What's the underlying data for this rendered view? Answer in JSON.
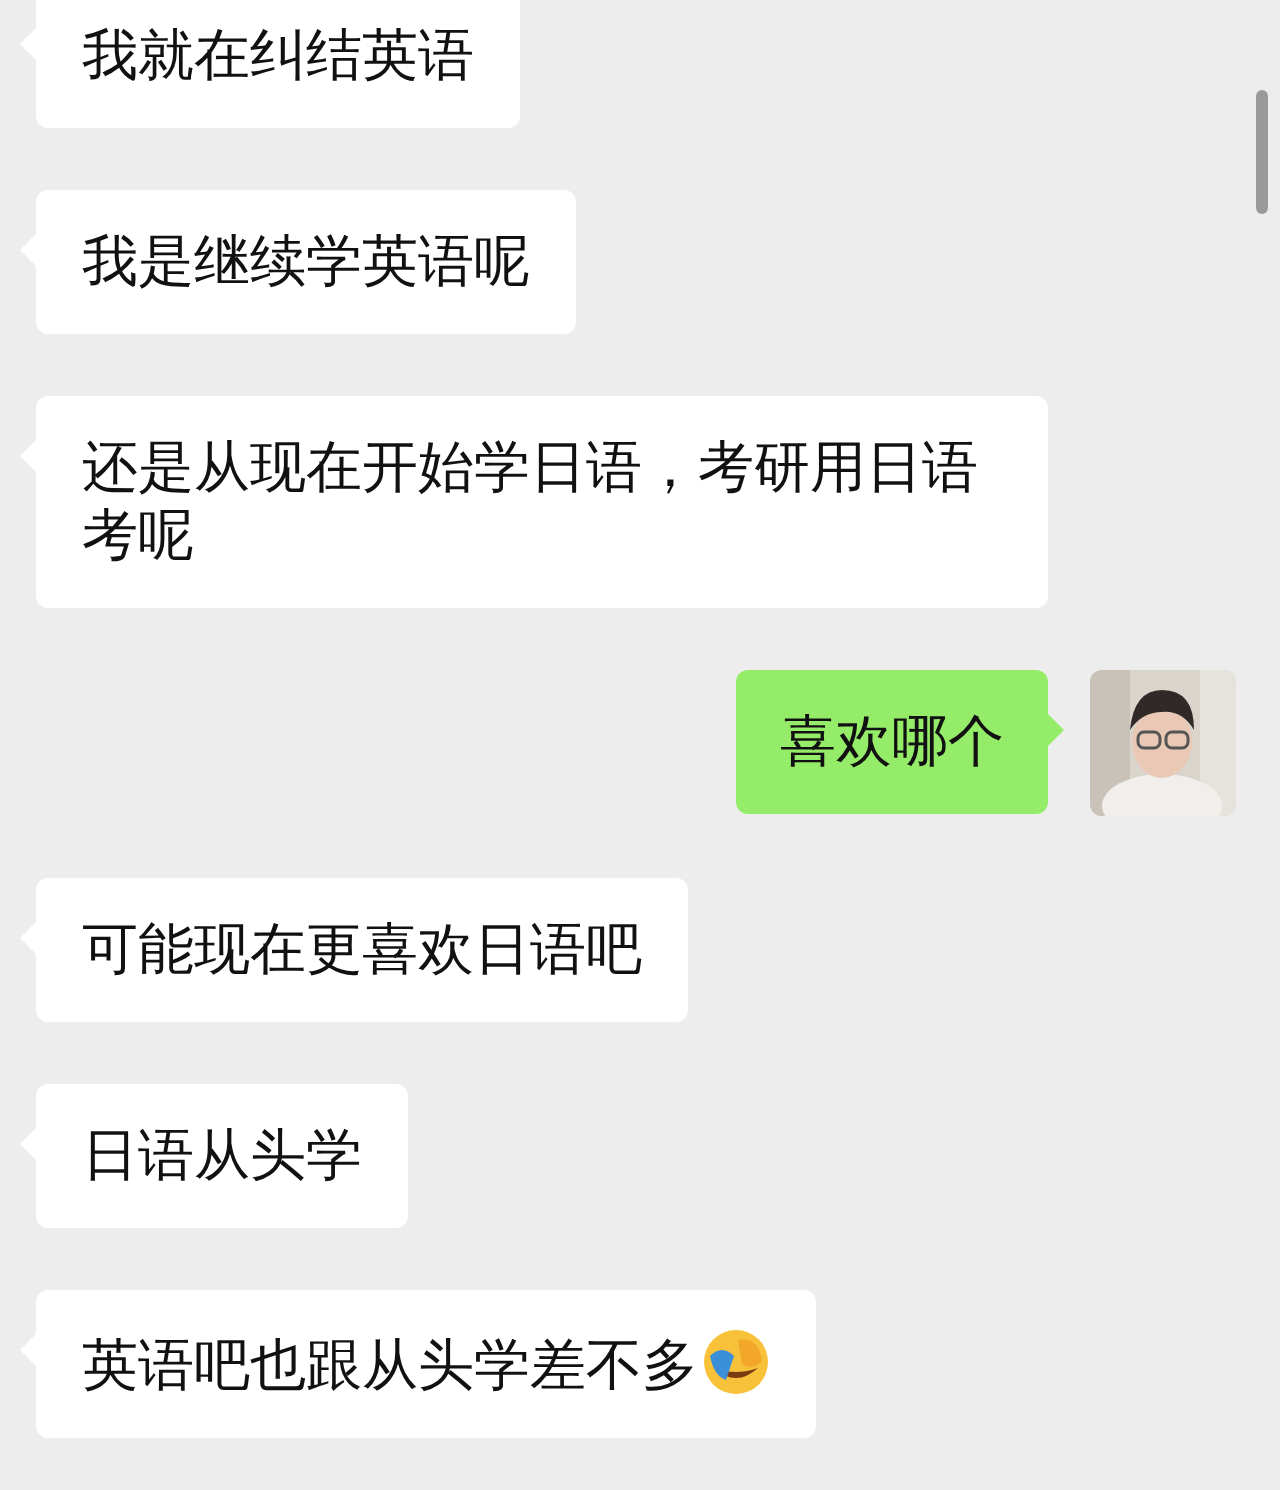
{
  "messages": [
    {
      "kind": "incoming",
      "text": "我就在纠结英语",
      "emoji": false
    },
    {
      "kind": "incoming",
      "text": "我是继续学英语呢",
      "emoji": false
    },
    {
      "kind": "incoming",
      "text": "还是从现在开始学日语，考研用日语考呢",
      "emoji": false
    },
    {
      "kind": "outgoing",
      "text": "喜欢哪个",
      "emoji": false
    },
    {
      "kind": "incoming",
      "text": "可能现在更喜欢日语吧",
      "emoji": false
    },
    {
      "kind": "incoming",
      "text": "日语从头学",
      "emoji": false
    },
    {
      "kind": "incoming",
      "text": "英语吧也跟从头学差不多",
      "emoji": true
    }
  ]
}
